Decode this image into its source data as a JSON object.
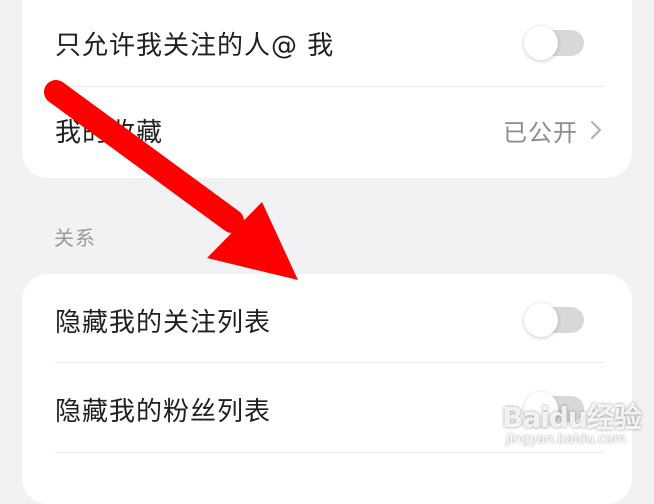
{
  "privacy": {
    "mention_row": {
      "label": "只允许我关注的人@ 我",
      "toggle_on": false
    },
    "favorites_row": {
      "label": "我的收藏",
      "value": "已公开"
    }
  },
  "relations": {
    "section_label": "关系",
    "hide_following_row": {
      "label": "隐藏我的关注列表",
      "toggle_on": false
    },
    "hide_fans_row": {
      "label": "隐藏我的粉丝列表",
      "toggle_on": false
    }
  },
  "watermark": {
    "main": "Baidu经验",
    "sub": "jingyan.baidu.com"
  },
  "colors": {
    "annotation_arrow": "#ff0000",
    "toggle_off_track": "#d8d8d8",
    "background": "#f2f2f4"
  }
}
